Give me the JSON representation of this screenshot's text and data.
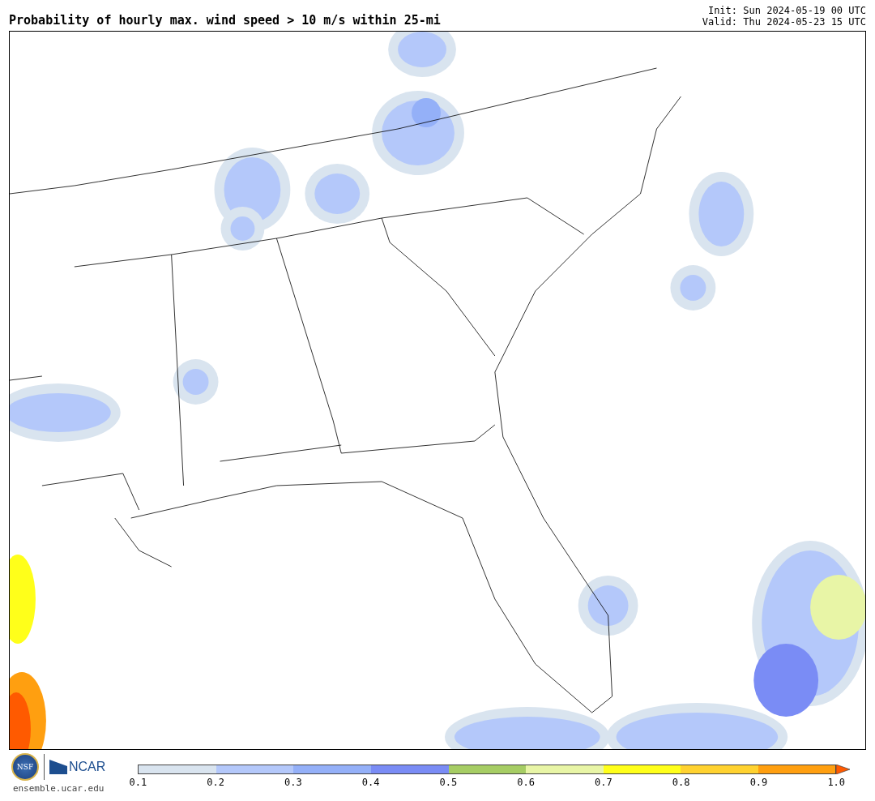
{
  "title": "Probability of hourly max. wind speed > 10 m/s within 25-mi",
  "init": "Init: Sun 2024-05-19 00 UTC",
  "valid": "Valid: Thu 2024-05-23 15 UTC",
  "footer": {
    "logo_left": "NSF",
    "logo_right": "NCAR",
    "url": "ensemble.ucar.edu"
  },
  "colorbar": {
    "segments": [
      {
        "kind": "block",
        "color": "#d9e4ef"
      },
      {
        "kind": "block",
        "color": "#b4c8fa"
      },
      {
        "kind": "block",
        "color": "#94b0f8"
      },
      {
        "kind": "block",
        "color": "#7a8cf5"
      },
      {
        "kind": "block",
        "color": "#a6cd64"
      },
      {
        "kind": "block",
        "color": "#e8f5a6"
      },
      {
        "kind": "block",
        "color": "#ffff1a"
      },
      {
        "kind": "block",
        "color": "#ffd230"
      },
      {
        "kind": "block",
        "color": "#ff9f10"
      },
      {
        "kind": "arrow",
        "color": "#ff5a00"
      }
    ],
    "ticks": [
      "0.1",
      "0.2",
      "0.3",
      "0.4",
      "0.5",
      "0.6",
      "0.7",
      "0.8",
      "0.9",
      "1.0"
    ]
  }
}
